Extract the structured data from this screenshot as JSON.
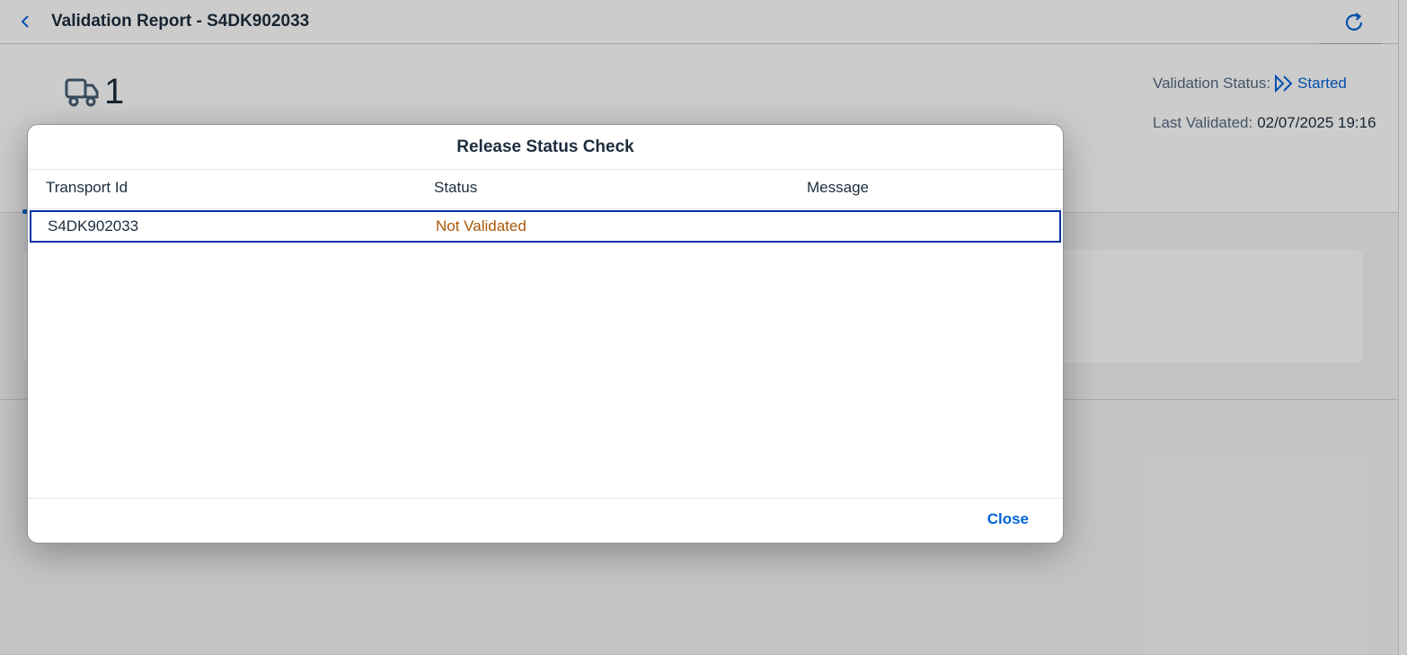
{
  "header": {
    "title": "Validation Report - S4DK902033",
    "back_icon": "chevron-left-icon",
    "refresh_icon": "refresh-icon"
  },
  "object_header": {
    "kpi_icon": "truck-icon",
    "kpi_value": "1",
    "validation_status_label": "Validation Status:",
    "validation_status_value": "Started",
    "status_icon": "double-chevron-right-icon",
    "last_validated_label": "Last Validated:",
    "last_validated_value": "02/07/2025 19:16"
  },
  "dialog": {
    "title": "Release Status Check",
    "columns": [
      "Transport Id",
      "Status",
      "Message"
    ],
    "rows": [
      {
        "transport_id": "S4DK902033",
        "status": "Not Validated",
        "message": ""
      }
    ],
    "close_label": "Close"
  },
  "colors": {
    "accent": "#0064d9",
    "warning_text": "#aa5808",
    "selection_border": "#0032a5",
    "text": "#1d2d3e"
  }
}
